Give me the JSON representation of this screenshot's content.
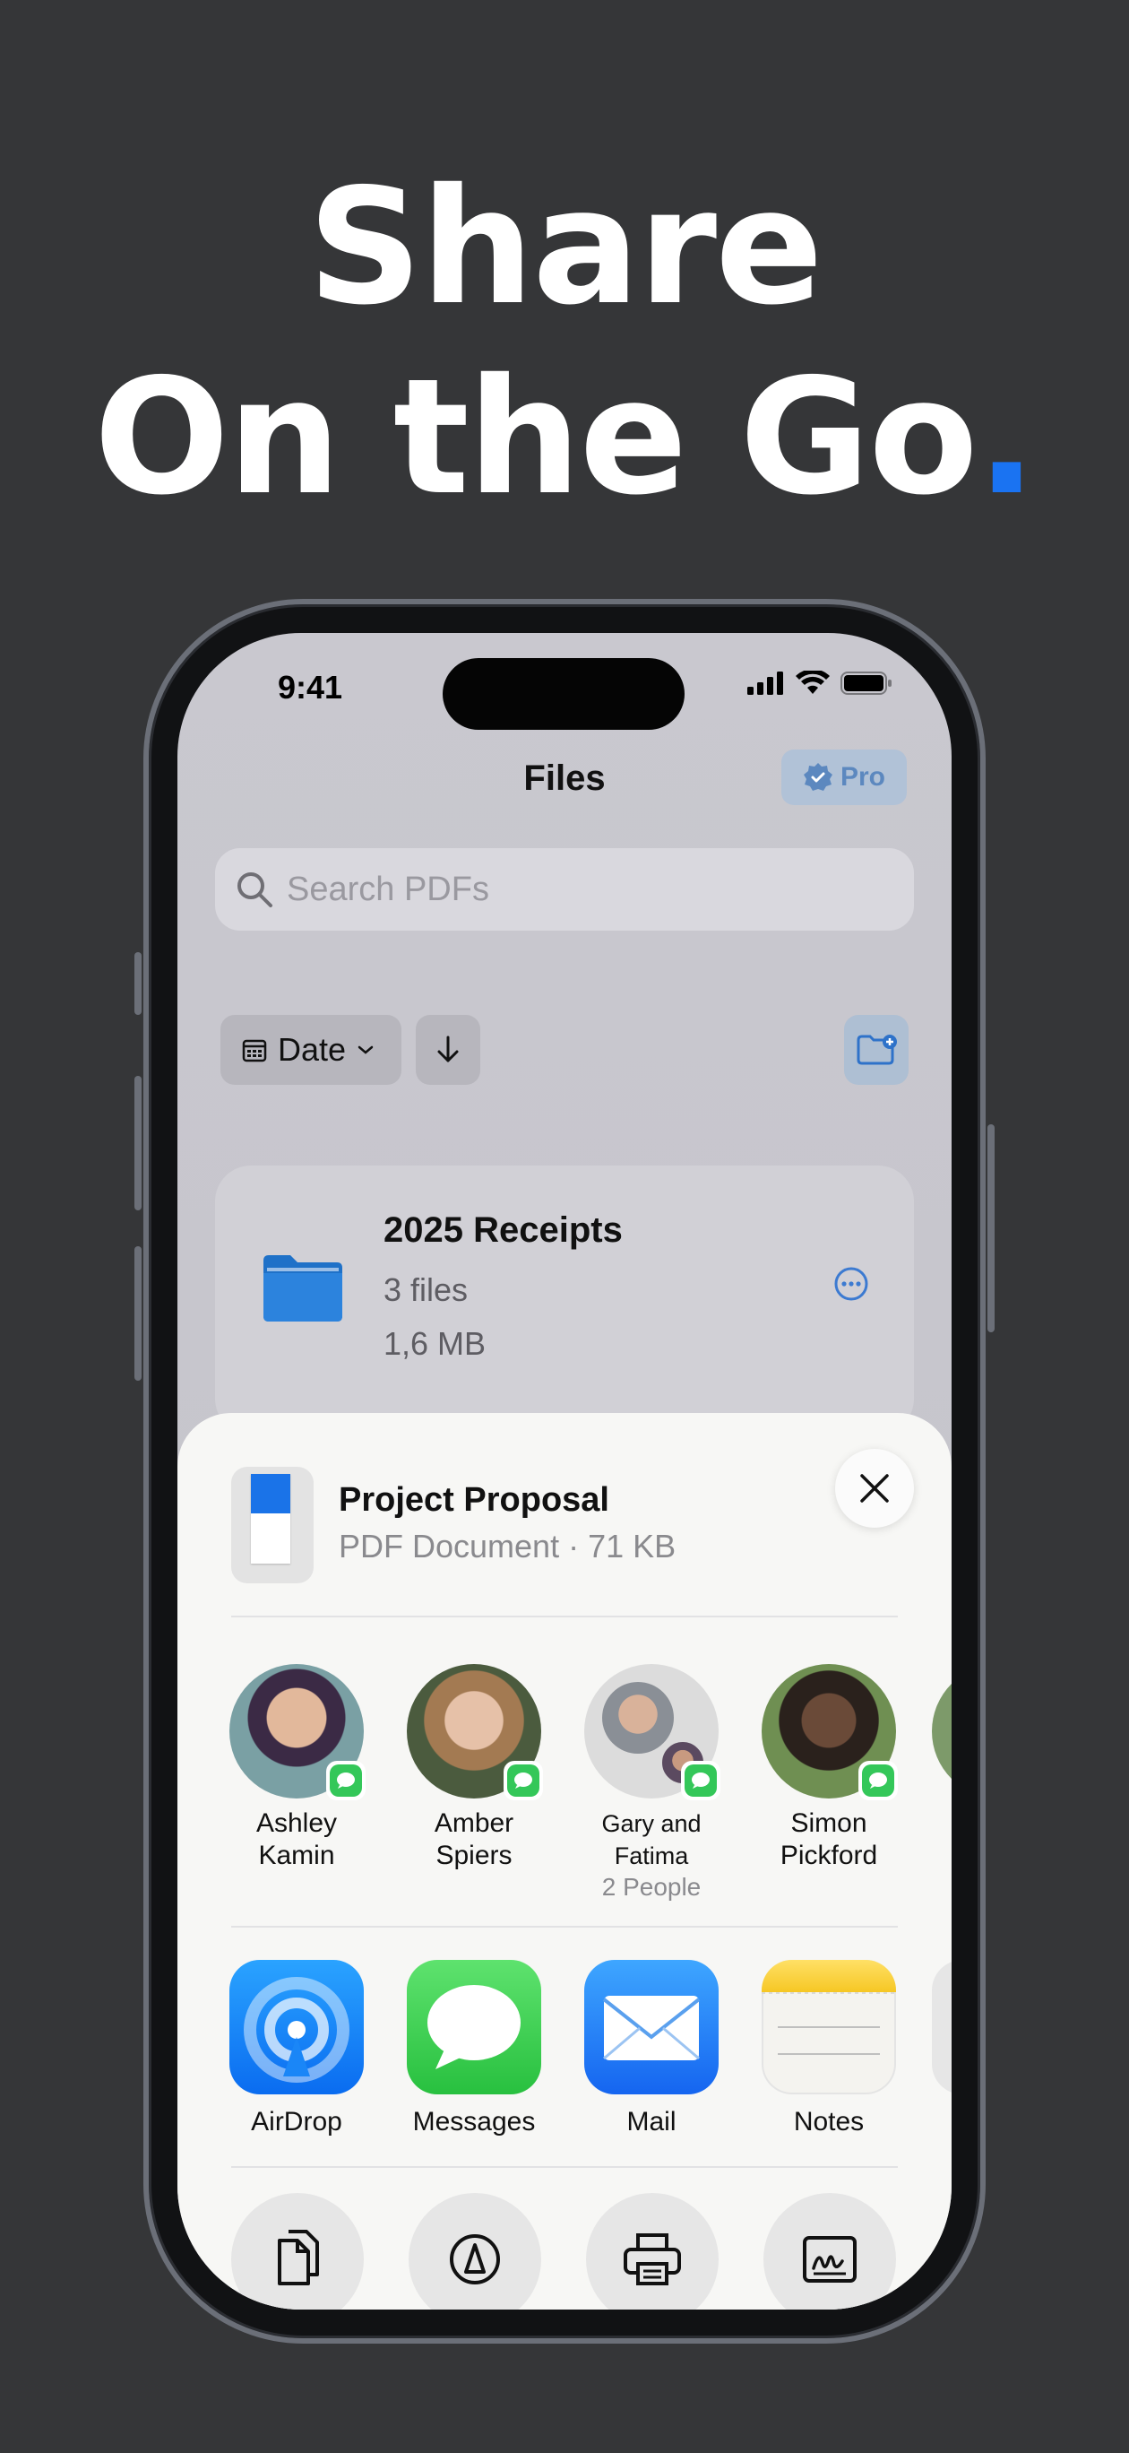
{
  "headline": {
    "line1": "Share",
    "line2": "On the Go",
    "dot": "."
  },
  "status": {
    "time": "9:41"
  },
  "nav": {
    "title": "Files",
    "pro_label": "Pro"
  },
  "search": {
    "placeholder": "Search PDFs"
  },
  "sort": {
    "label": "Date"
  },
  "folder": {
    "name": "2025 Receipts",
    "count": "3 files",
    "size": "1,6 MB"
  },
  "share_sheet": {
    "doc_title": "Project Proposal",
    "doc_subtitle": "PDF Document · 71 KB",
    "people": [
      {
        "line1": "Ashley",
        "line2": "Kamin"
      },
      {
        "line1": "Amber",
        "line2": "Spiers"
      },
      {
        "line1": "Gary and Fatima",
        "sub": "2 People"
      },
      {
        "line1": "Simon",
        "line2": "Pickford"
      }
    ],
    "apps": [
      "AirDrop",
      "Messages",
      "Mail",
      "Notes"
    ]
  },
  "colors": {
    "accent": "#1a73f2",
    "messages_green": "#34c759",
    "background": "#353638"
  }
}
